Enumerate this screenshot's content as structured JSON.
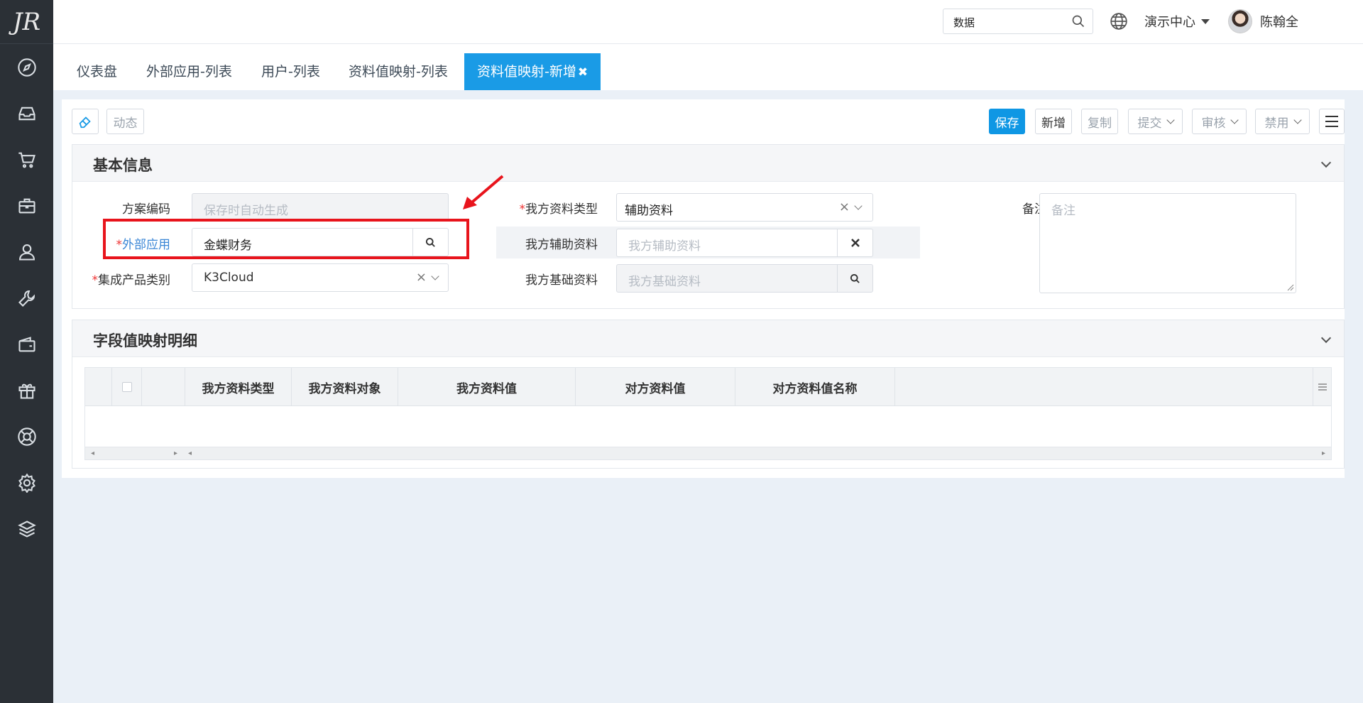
{
  "app": {
    "logo_text": "JR"
  },
  "sidebar": {
    "icons": [
      "compass-icon",
      "inbox-icon",
      "cart-icon",
      "briefcase-icon",
      "user-icon",
      "wrench-icon",
      "wallet-icon",
      "gift-icon",
      "lifebuoy-icon",
      "gear-icon",
      "layers-icon"
    ]
  },
  "header": {
    "search_value": "数据",
    "org": "演示中心",
    "user": "陈翰全",
    "help": "?"
  },
  "tabs": [
    {
      "label": "仪表盘"
    },
    {
      "label": "外部应用-列表"
    },
    {
      "label": "用户-列表"
    },
    {
      "label": "资料值映射-列表"
    },
    {
      "label": "资料值映射-新增",
      "close": "✖",
      "active": true
    }
  ],
  "toolbar": {
    "dynamic": "动态",
    "save": "保存",
    "add": "新增",
    "copy": "复制",
    "submit": "提交",
    "audit": "审核",
    "disable": "禁用"
  },
  "basic_info": {
    "title": "基本信息",
    "scheme_code_label": "方案编码",
    "scheme_code_placeholder": "保存时自动生成",
    "external_app_label": "外部应用",
    "external_app_value": "金蝶财务",
    "product_type_label": "集成产品类别",
    "product_type_value": "K3Cloud",
    "our_type_label": "我方资料类型",
    "our_type_value": "辅助资料",
    "our_aux_label": "我方辅助资料",
    "our_aux_placeholder": "我方辅助资料",
    "our_base_label": "我方基础资料",
    "our_base_placeholder": "我方基础资料",
    "remark_label": "备注",
    "remark_placeholder": "备注",
    "required_mark": "*"
  },
  "mapping_detail": {
    "title": "字段值映射明细",
    "columns": [
      "我方资料类型",
      "我方资料对象",
      "我方资料值",
      "对方资料值",
      "对方资料值名称"
    ]
  },
  "colors": {
    "accent": "#1a9be6",
    "sidebar": "#2b3036",
    "highlight": "#e8141c"
  }
}
